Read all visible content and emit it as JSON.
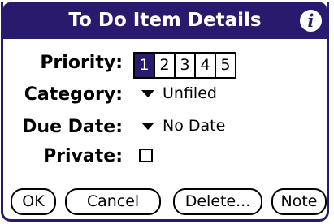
{
  "dialog": {
    "title": "To Do Item Details",
    "info_icon": "i"
  },
  "priority": {
    "label": "Priority:",
    "options": [
      "1",
      "2",
      "3",
      "4",
      "5"
    ],
    "selected": "1"
  },
  "category": {
    "label": "Category:",
    "value": "Unfiled"
  },
  "due_date": {
    "label": "Due Date:",
    "value": "No Date"
  },
  "private": {
    "label": "Private:",
    "checked": false
  },
  "buttons": {
    "ok": "OK",
    "cancel": "Cancel",
    "delete": "Delete...",
    "note": "Note"
  },
  "colors": {
    "title_bar": "#2a1a6e",
    "selected_priority": "#2a1a6e"
  }
}
